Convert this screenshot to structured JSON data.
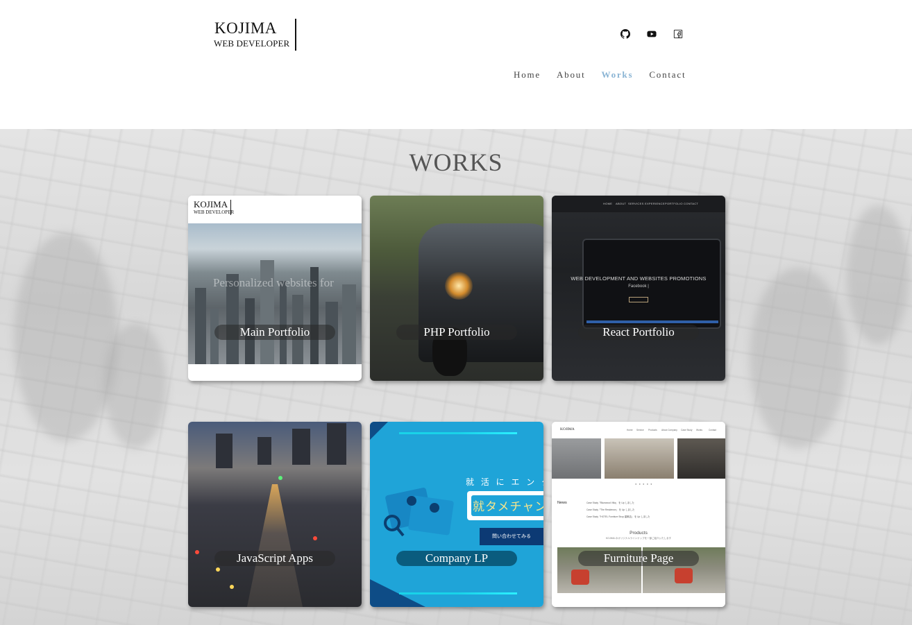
{
  "header": {
    "logo_name": "KOJIMA",
    "logo_sub": "WEB DEVELOPER",
    "social": [
      {
        "icon": "github-icon"
      },
      {
        "icon": "youtube-icon"
      },
      {
        "icon": "facebook-icon"
      }
    ],
    "nav": [
      {
        "label": "Home",
        "active": false
      },
      {
        "label": "About",
        "active": false
      },
      {
        "label": "Works",
        "active": true
      },
      {
        "label": "Contact",
        "active": false
      }
    ],
    "active_color": "#8ab4d4"
  },
  "works": {
    "title": "WORKS",
    "cards": [
      {
        "label": "Main Portfolio",
        "thumb": {
          "logo_name": "KOJIMA",
          "logo_sub": "WEB DEVELOPER",
          "overlay_text": "Personalized websites for"
        }
      },
      {
        "label": "PHP Portfolio"
      },
      {
        "label": "React Portfolio",
        "thumb": {
          "nav": [
            "HOME",
            "ABOUT",
            "SERVICES",
            "EXPERIENCE",
            "PORTFOLIO",
            "CONTACT"
          ],
          "headline": "WEB DEVELOPMENT AND WEBSITES PROMOTIONS",
          "sub": "Facebook |"
        }
      },
      {
        "label": "JavaScript Apps"
      },
      {
        "label": "Company LP",
        "thumb": {
          "tagline": "就 活 に エ ン タ メ",
          "brand": "就タメチャンネ",
          "cta": "問い合わせてみる"
        }
      },
      {
        "label": "Furniture Page",
        "thumb": {
          "logo": "KOJIMA",
          "nav": [
            "Home",
            "Service",
            "Products",
            "About Company",
            "Case Study",
            "Works",
            "Contact"
          ],
          "news_heading": "News",
          "news": [
            "Case Study「Bluewood Villa」 を Up しました",
            "Case Study「The Residence」 を Up しました",
            "Case Study「HOTEL Furniture Shop 建築店」 を Up しました"
          ],
          "products_heading": "Products",
          "products_sub": "KOJIMA のオリジナルラインナップを一部ご紹介いたします"
        }
      }
    ]
  }
}
